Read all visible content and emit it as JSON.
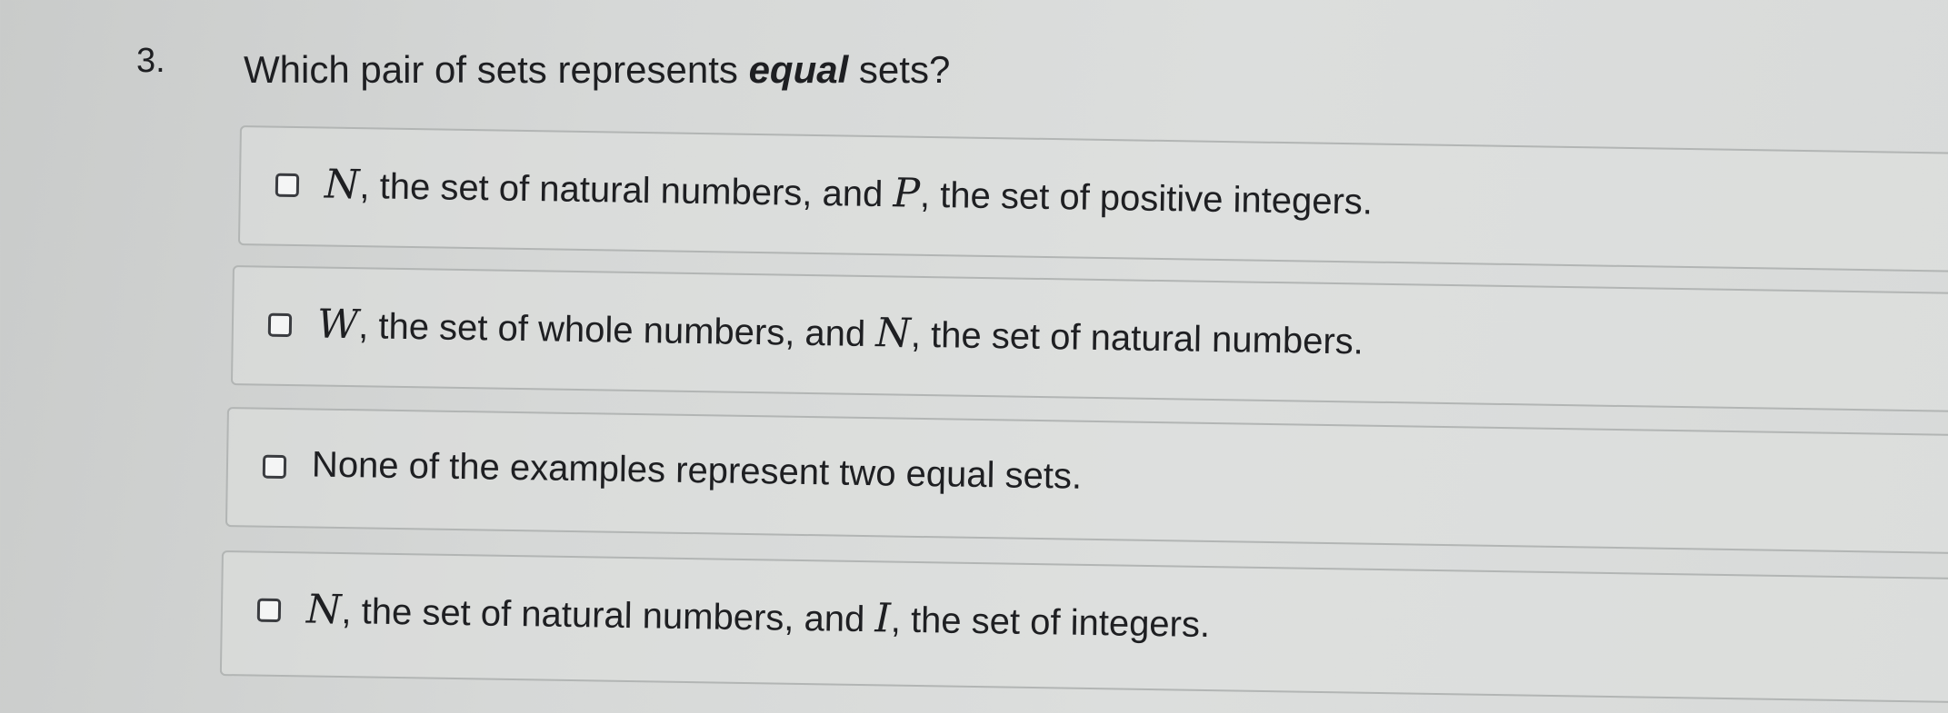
{
  "question": {
    "number": "3.",
    "text_before": "Which pair of sets represents ",
    "text_emphasis": "equal",
    "text_after": " sets?"
  },
  "options": [
    {
      "var1": "N",
      "text1": ", the set of natural numbers, and ",
      "var2": "P",
      "text2": ", the set of positive integers.",
      "checked": false
    },
    {
      "var1": "W",
      "text1": ", the set of whole numbers, and ",
      "var2": "N",
      "text2": ", the set of natural numbers.",
      "checked": false
    },
    {
      "text": "None of the examples represent two equal sets.",
      "checked": false
    },
    {
      "var1": "N",
      "text1": ", the set of natural numbers, and ",
      "var2": "I",
      "text2": ", the set of integers.",
      "checked": false
    }
  ]
}
